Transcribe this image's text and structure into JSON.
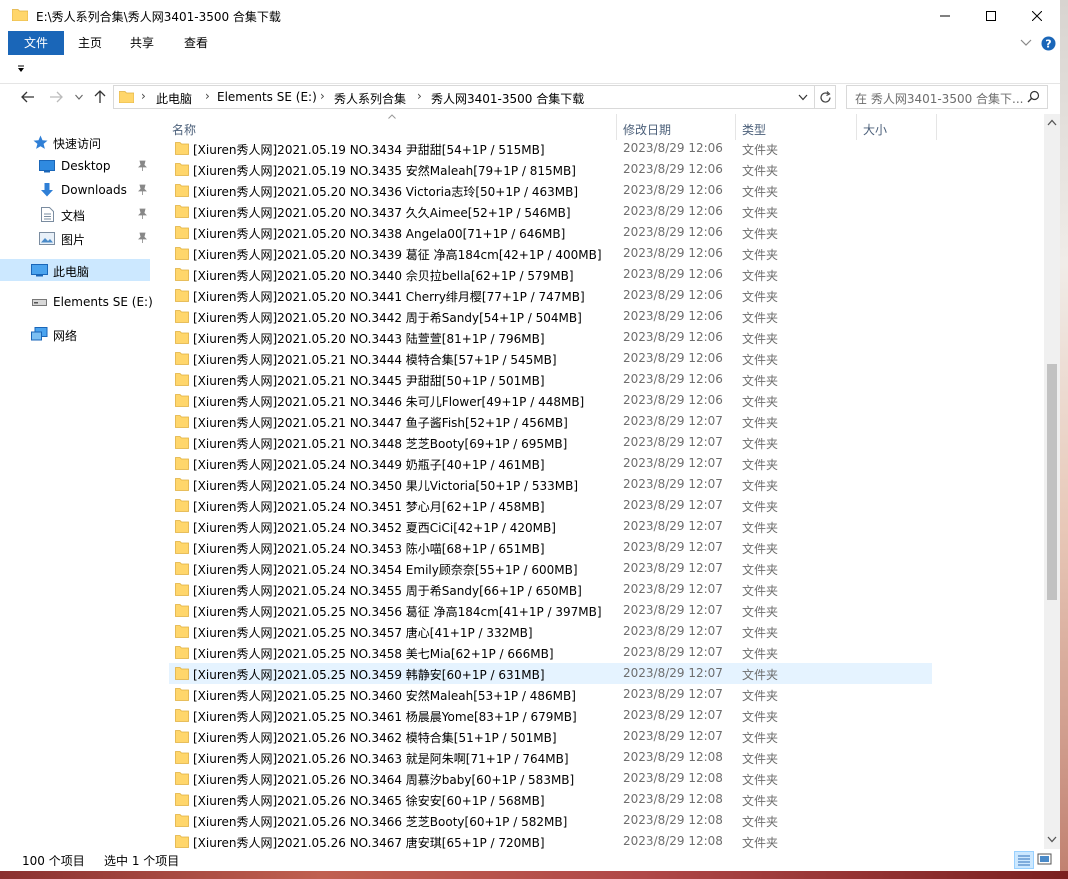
{
  "window": {
    "title": "E:\\秀人系列合集\\秀人网3401-3500 合集下载"
  },
  "ribbon": {
    "tabs": [
      "文件",
      "主页",
      "共享",
      "查看"
    ]
  },
  "address": {
    "crumbs": [
      "此电脑",
      "Elements SE (E:)",
      "秀人系列合集",
      "秀人网3401-3500 合集下载"
    ]
  },
  "search": {
    "placeholder": "在 秀人网3401-3500 合集下..."
  },
  "sidebar": {
    "items": [
      {
        "label": "快速访问"
      },
      {
        "label": "Desktop"
      },
      {
        "label": "Downloads"
      },
      {
        "label": "文档"
      },
      {
        "label": "图片"
      },
      {
        "label": "此电脑"
      },
      {
        "label": "Elements SE (E:)"
      },
      {
        "label": "网络"
      }
    ]
  },
  "columns": {
    "name": "名称",
    "date": "修改日期",
    "type": "类型",
    "size": "大小"
  },
  "files": [
    {
      "name": "[Xiuren秀人网]2021.05.19 NO.3434 尹甜甜[54+1P / 515MB]",
      "date": "2023/8/29 12:06",
      "type": "文件夹"
    },
    {
      "name": "[Xiuren秀人网]2021.05.19 NO.3435 安然Maleah[79+1P / 815MB]",
      "date": "2023/8/29 12:06",
      "type": "文件夹"
    },
    {
      "name": "[Xiuren秀人网]2021.05.20 NO.3436 Victoria志玲[50+1P / 463MB]",
      "date": "2023/8/29 12:06",
      "type": "文件夹"
    },
    {
      "name": "[Xiuren秀人网]2021.05.20 NO.3437 久久Aimee[52+1P / 546MB]",
      "date": "2023/8/29 12:06",
      "type": "文件夹"
    },
    {
      "name": "[Xiuren秀人网]2021.05.20 NO.3438 Angela00[71+1P / 646MB]",
      "date": "2023/8/29 12:06",
      "type": "文件夹"
    },
    {
      "name": "[Xiuren秀人网]2021.05.20 NO.3439 葛征 净高184cm[42+1P / 400MB]",
      "date": "2023/8/29 12:06",
      "type": "文件夹"
    },
    {
      "name": "[Xiuren秀人网]2021.05.20 NO.3440 佘贝拉bella[62+1P / 579MB]",
      "date": "2023/8/29 12:06",
      "type": "文件夹"
    },
    {
      "name": "[Xiuren秀人网]2021.05.20 NO.3441 Cherry绯月樱[77+1P / 747MB]",
      "date": "2023/8/29 12:06",
      "type": "文件夹"
    },
    {
      "name": "[Xiuren秀人网]2021.05.20 NO.3442 周于希Sandy[54+1P / 504MB]",
      "date": "2023/8/29 12:06",
      "type": "文件夹"
    },
    {
      "name": "[Xiuren秀人网]2021.05.20 NO.3443 陆萱萱[81+1P / 796MB]",
      "date": "2023/8/29 12:06",
      "type": "文件夹"
    },
    {
      "name": "[Xiuren秀人网]2021.05.21 NO.3444 模特合集[57+1P / 545MB]",
      "date": "2023/8/29 12:06",
      "type": "文件夹"
    },
    {
      "name": "[Xiuren秀人网]2021.05.21 NO.3445 尹甜甜[50+1P / 501MB]",
      "date": "2023/8/29 12:06",
      "type": "文件夹"
    },
    {
      "name": "[Xiuren秀人网]2021.05.21 NO.3446 朱可儿Flower[49+1P / 448MB]",
      "date": "2023/8/29 12:06",
      "type": "文件夹"
    },
    {
      "name": "[Xiuren秀人网]2021.05.21 NO.3447 鱼子酱Fish[52+1P / 456MB]",
      "date": "2023/8/29 12:07",
      "type": "文件夹"
    },
    {
      "name": "[Xiuren秀人网]2021.05.21 NO.3448 芝芝Booty[69+1P / 695MB]",
      "date": "2023/8/29 12:07",
      "type": "文件夹"
    },
    {
      "name": "[Xiuren秀人网]2021.05.24 NO.3449 奶瓶子[40+1P / 461MB]",
      "date": "2023/8/29 12:07",
      "type": "文件夹"
    },
    {
      "name": "[Xiuren秀人网]2021.05.24 NO.3450 果儿Victoria[50+1P / 533MB]",
      "date": "2023/8/29 12:07",
      "type": "文件夹"
    },
    {
      "name": "[Xiuren秀人网]2021.05.24 NO.3451 梦心月[62+1P / 458MB]",
      "date": "2023/8/29 12:07",
      "type": "文件夹"
    },
    {
      "name": "[Xiuren秀人网]2021.05.24 NO.3452 夏西CiCi[42+1P / 420MB]",
      "date": "2023/8/29 12:07",
      "type": "文件夹"
    },
    {
      "name": "[Xiuren秀人网]2021.05.24 NO.3453 陈小喵[68+1P / 651MB]",
      "date": "2023/8/29 12:07",
      "type": "文件夹"
    },
    {
      "name": "[Xiuren秀人网]2021.05.24 NO.3454 Emily顾奈奈[55+1P / 600MB]",
      "date": "2023/8/29 12:07",
      "type": "文件夹"
    },
    {
      "name": "[Xiuren秀人网]2021.05.24 NO.3455 周于希Sandy[66+1P / 650MB]",
      "date": "2023/8/29 12:07",
      "type": "文件夹"
    },
    {
      "name": "[Xiuren秀人网]2021.05.25 NO.3456 葛征 净高184cm[41+1P / 397MB]",
      "date": "2023/8/29 12:07",
      "type": "文件夹"
    },
    {
      "name": "[Xiuren秀人网]2021.05.25 NO.3457 唐心[41+1P / 332MB]",
      "date": "2023/8/29 12:07",
      "type": "文件夹"
    },
    {
      "name": "[Xiuren秀人网]2021.05.25 NO.3458 美七Mia[62+1P / 666MB]",
      "date": "2023/8/29 12:07",
      "type": "文件夹"
    },
    {
      "name": "[Xiuren秀人网]2021.05.25 NO.3459 韩静安[60+1P / 631MB]",
      "date": "2023/8/29 12:07",
      "type": "文件夹"
    },
    {
      "name": "[Xiuren秀人网]2021.05.25 NO.3460 安然Maleah[53+1P / 486MB]",
      "date": "2023/8/29 12:07",
      "type": "文件夹"
    },
    {
      "name": "[Xiuren秀人网]2021.05.25 NO.3461 杨晨晨Yome[83+1P / 679MB]",
      "date": "2023/8/29 12:07",
      "type": "文件夹"
    },
    {
      "name": "[Xiuren秀人网]2021.05.26 NO.3462 模特合集[51+1P / 501MB]",
      "date": "2023/8/29 12:07",
      "type": "文件夹"
    },
    {
      "name": "[Xiuren秀人网]2021.05.26 NO.3463 就是阿朱啊[71+1P / 764MB]",
      "date": "2023/8/29 12:08",
      "type": "文件夹"
    },
    {
      "name": "[Xiuren秀人网]2021.05.26 NO.3464 周慕汐baby[60+1P / 583MB]",
      "date": "2023/8/29 12:08",
      "type": "文件夹"
    },
    {
      "name": "[Xiuren秀人网]2021.05.26 NO.3465 徐安安[60+1P / 568MB]",
      "date": "2023/8/29 12:08",
      "type": "文件夹"
    },
    {
      "name": "[Xiuren秀人网]2021.05.26 NO.3466 芝芝Booty[60+1P / 582MB]",
      "date": "2023/8/29 12:08",
      "type": "文件夹"
    },
    {
      "name": "[Xiuren秀人网]2021.05.26 NO.3467 唐安琪[65+1P / 720MB]",
      "date": "2023/8/29 12:08",
      "type": "文件夹"
    }
  ],
  "highlighted_row": 25,
  "status": {
    "count": "100 个项目",
    "selected": "选中 1 个项目"
  },
  "colors": {
    "accent": "#1a66b8",
    "selection": "#cce8ff",
    "hover": "#e5f3ff",
    "folder": "#ffd66b"
  }
}
